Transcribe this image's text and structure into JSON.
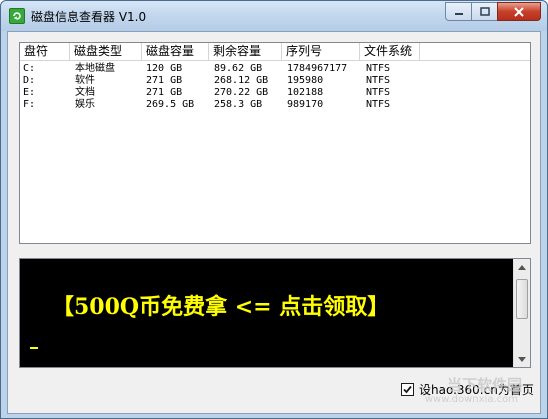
{
  "window": {
    "title": "磁盘信息查看器 V1.0"
  },
  "listview": {
    "columns": [
      "盘符",
      "磁盘类型",
      "磁盘容量",
      "剩余容量",
      "序列号",
      "文件系统"
    ],
    "rows": [
      [
        "C:",
        "本地磁盘",
        "120 GB",
        "89.62 GB",
        "1784967177",
        "NTFS"
      ],
      [
        "D:",
        "软件",
        "271 GB",
        "268.12 GB",
        "195980",
        "NTFS"
      ],
      [
        "E:",
        "文档",
        "271 GB",
        "270.22 GB",
        "102188",
        "NTFS"
      ],
      [
        "F:",
        "娱乐",
        "269.5 GB",
        "258.3 GB",
        "989170",
        "NTFS"
      ]
    ]
  },
  "console": {
    "promo_text": "【500Q币免费拿 <= 点击领取】",
    "text_color": "#ffff00",
    "background": "#000000"
  },
  "homepage_option": {
    "label": "设hao.360.cn为首页",
    "checked": true
  },
  "watermark": {
    "line1": "当下软件园",
    "line2": "www.downxia.com"
  }
}
